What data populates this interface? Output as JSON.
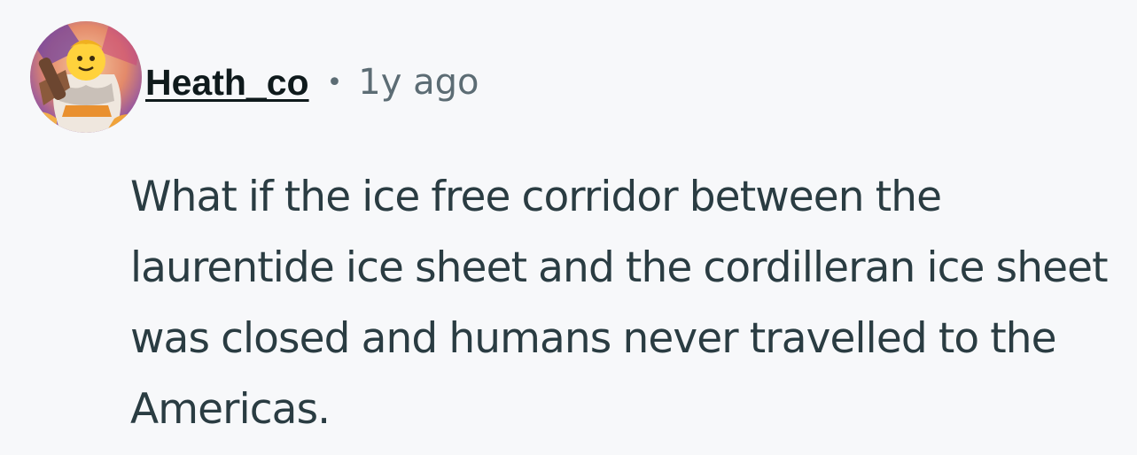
{
  "comment": {
    "author": "Heath_co",
    "separator": "•",
    "timestamp": "1y ago",
    "avatar_icon": "snoo-avatar-icon",
    "body": "What if the ice free corridor between the laurentide ice sheet and the cordilleran ice sheet was closed and humans never travelled to the Americas."
  },
  "colors": {
    "background": "#f7f8fa",
    "author": "#0f1a1c",
    "meta": "#5c6c74",
    "body_text": "#2a3c42"
  }
}
